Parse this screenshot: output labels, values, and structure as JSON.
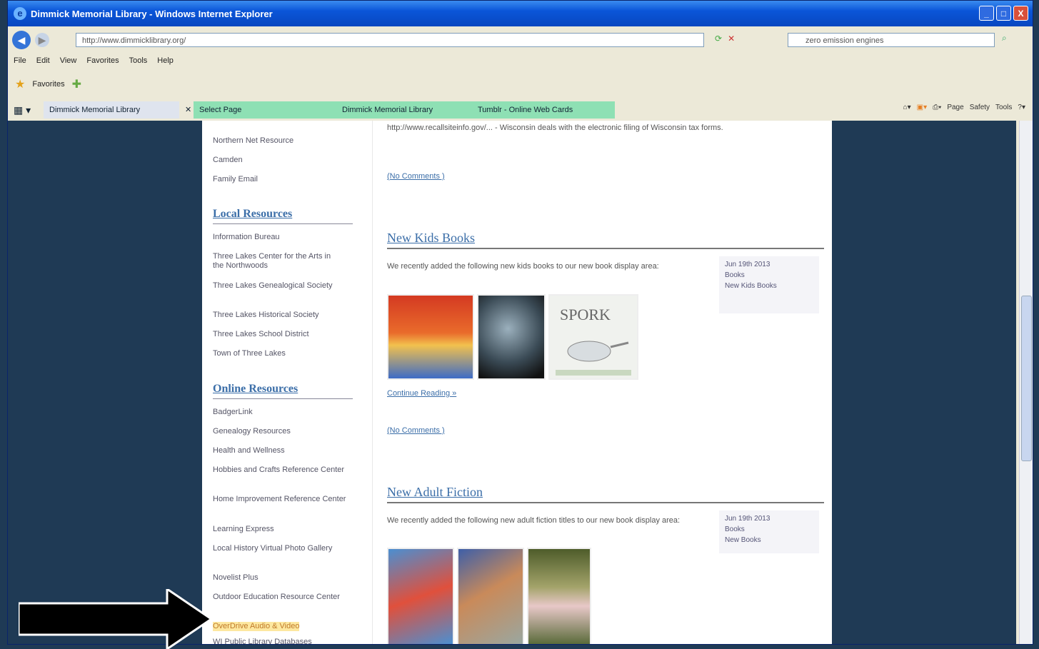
{
  "window": {
    "title": "Dimmick Memorial Library - Windows Internet Explorer",
    "controls": [
      "_",
      "□",
      "X"
    ]
  },
  "address_bar": {
    "url": "http://www.dimmicklibrary.org/",
    "search_placeholder": "zero emission engines"
  },
  "menu": [
    "File",
    "Edit",
    "View",
    "Favorites",
    "Tools",
    "Help"
  ],
  "favorites_bar": {
    "label": "Favorites"
  },
  "tabs": [
    {
      "label": "Dimmick Memorial Library"
    },
    {
      "label": "Select Page"
    },
    {
      "label": "Dimmick Memorial Library"
    },
    {
      "label": "Tumblr - Online Web Cards"
    }
  ],
  "command_bar": [
    "Page",
    "Safety",
    "Tools"
  ],
  "sidebar": {
    "top_links": [
      "Northern Net Resource",
      "Camden",
      "Family Email"
    ],
    "local_heading": "Local Resources",
    "local_links": [
      "Information Bureau",
      "Three Lakes Center for the Arts in the Northwoods",
      "Three Lakes Genealogical Society",
      "Three Lakes Historical Society",
      "Three Lakes School District",
      "Town of Three Lakes"
    ],
    "online_heading": "Online Resources",
    "online_links": [
      "BadgerLink",
      "Genealogy Resources",
      "Health and Wellness",
      "Hobbies and Crafts Reference Center",
      "Home Improvement Reference Center",
      "Learning Express",
      "Local History Virtual Photo Gallery",
      "Novelist Plus",
      "Outdoor Education Resource Center",
      "OverDrive Audio & Video",
      "WI Public Library Databases"
    ]
  },
  "main": {
    "top_text": "http://www.recallsiteinfo.gov/... - Wisconsin deals with the electronic filing of Wisconsin tax forms.",
    "top_comments": "(No Comments )",
    "posts": [
      {
        "title": "New Kids Books",
        "body": "We recently added the following new kids books to our new book display area:",
        "meta": [
          "Jun 19th 2013",
          "Books",
          "New Kids Books"
        ],
        "continue": "Continue Reading »",
        "comments": "(No Comments )"
      },
      {
        "title": "New Adult Fiction",
        "body": "We recently added the following new adult fiction titles to our new book display area:",
        "meta": [
          "Jun 19th 2013",
          "Books",
          "New Books"
        ]
      }
    ]
  }
}
